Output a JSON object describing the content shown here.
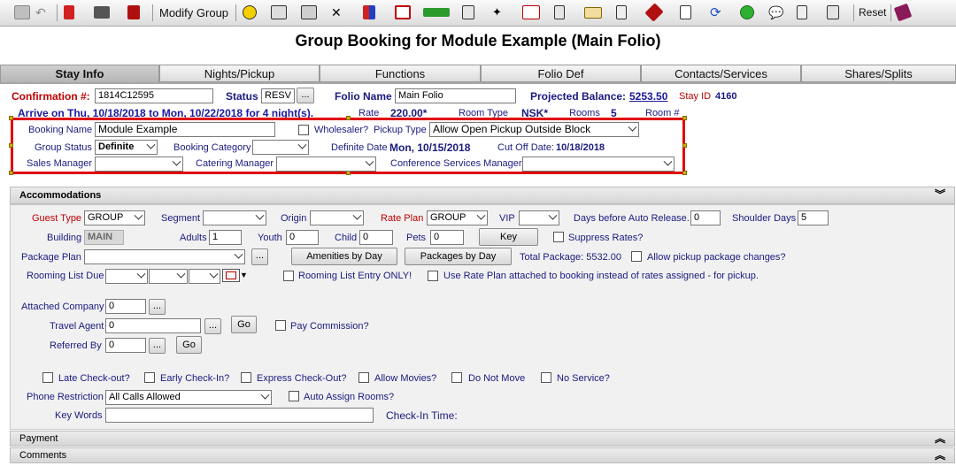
{
  "toolbar": {
    "modify_group": "Modify Group",
    "reset": "Reset"
  },
  "page_title": "Group Booking for Module Example (Main Folio)",
  "tabs": [
    "Stay Info",
    "Nights/Pickup",
    "Functions",
    "Folio Def",
    "Contacts/Services",
    "Shares/Splits"
  ],
  "header": {
    "confirmation_label": "Confirmation #:",
    "confirmation_value": "1814C12595",
    "status_label": "Status",
    "status_value": "RESV",
    "status_button": "...",
    "folio_name_label": "Folio Name",
    "folio_name_value": "Main Folio",
    "projected_balance_label": "Projected Balance:",
    "projected_balance_value": "5253.50",
    "stay_id_label": "Stay ID",
    "stay_id_value": "4160",
    "arrive_text": "Arrive on Thu, 10/18/2018 to Mon, 10/22/2018 for 4 night(s).",
    "rate_label": "Rate",
    "rate_value": "220.00*",
    "room_type_label": "Room Type",
    "room_type_value": "NSK*",
    "rooms_label": "Rooms",
    "rooms_value": "5",
    "room_num_label": "Room #"
  },
  "booking": {
    "booking_name_label": "Booking Name",
    "booking_name_value": "Module Example",
    "wholesaler_label": "Wholesaler?",
    "pickup_type_label": "Pickup Type",
    "pickup_type_value": "Allow Open Pickup Outside Block",
    "group_status_label": "Group Status",
    "group_status_value": "Definite",
    "booking_category_label": "Booking Category",
    "booking_category_value": "",
    "definite_date_label": "Definite Date",
    "definite_date_value": "Mon, 10/15/2018",
    "cutoff_date_label": "Cut Off Date:",
    "cutoff_date_value": "10/18/2018",
    "sales_manager_label": "Sales Manager",
    "catering_manager_label": "Catering Manager",
    "conference_manager_label": "Conference Services Manager"
  },
  "accommodations": {
    "title": "Accommodations",
    "guest_type_label": "Guest Type",
    "guest_type_value": "GROUP",
    "segment_label": "Segment",
    "origin_label": "Origin",
    "rate_plan_label": "Rate Plan",
    "rate_plan_value": "GROUP",
    "vip_label": "VIP",
    "days_auto_release_label": "Days before Auto Release.",
    "days_auto_release_value": "0",
    "shoulder_days_label": "Shoulder Days",
    "shoulder_days_value": "5",
    "building_label": "Building",
    "building_value": "MAIN",
    "adults_label": "Adults",
    "adults_value": "1",
    "youth_label": "Youth",
    "youth_value": "0",
    "child_label": "Child",
    "child_value": "0",
    "pets_label": "Pets",
    "pets_value": "0",
    "key_button": "Key",
    "suppress_rates_label": "Suppress Rates?",
    "package_plan_label": "Package Plan",
    "package_plan_button": "...",
    "amenities_button": "Amenities by Day",
    "packages_button": "Packages by Day",
    "total_package_label": "Total Package: 5532.00",
    "allow_pickup_pkg_label": "Allow pickup package changes?",
    "rooming_list_due_label": "Rooming List Due",
    "rooming_list_entry_label": "Rooming List Entry ONLY!",
    "use_rate_plan_label": "Use Rate Plan attached to booking instead of rates assigned - for pickup.",
    "attached_company_label": "Attached Company",
    "attached_company_value": "0",
    "travel_agent_label": "Travel Agent",
    "travel_agent_value": "0",
    "referred_by_label": "Referred By",
    "referred_by_value": "0",
    "ellipsis": "...",
    "go_button": "Go",
    "pay_commission_label": "Pay Commission?",
    "late_checkout_label": "Late Check-out?",
    "early_checkin_label": "Early Check-In?",
    "express_checkout_label": "Express Check-Out?",
    "allow_movies_label": "Allow Movies?",
    "do_not_move_label": "Do Not Move",
    "no_service_label": "No Service?",
    "phone_restriction_label": "Phone Restriction",
    "phone_restriction_value": "All Calls Allowed",
    "auto_assign_label": "Auto Assign Rooms?",
    "key_words_label": "Key Words",
    "key_words_value": "",
    "checkin_time_label": "Check-In Time:"
  },
  "payment_title": "Payment",
  "comments_title": "Comments",
  "colors": {
    "label_blue": "#1a1a80",
    "label_red": "#c00000",
    "highlight_red": "#e00000"
  }
}
